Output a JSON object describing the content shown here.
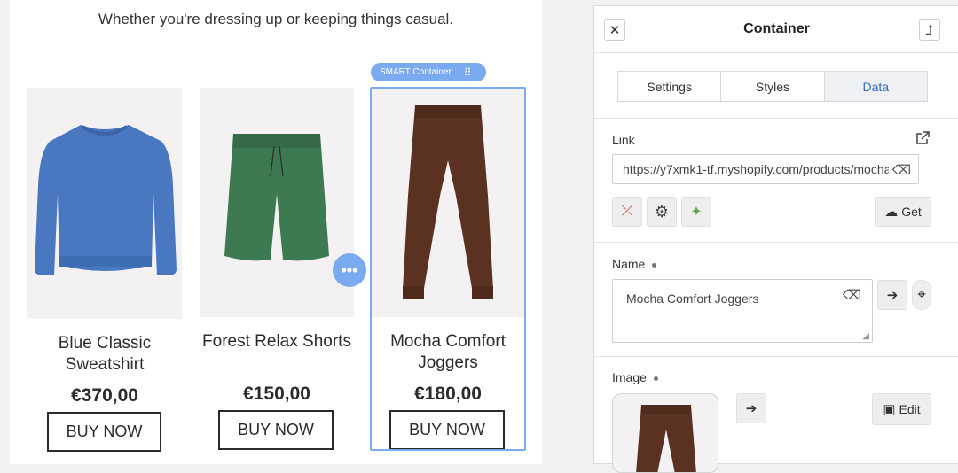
{
  "canvas": {
    "subtitle": "Whether you're dressing up or keeping things casual.",
    "smart_tag": "SMART Container",
    "more_button": "•••",
    "products": [
      {
        "name": "Blue Classic Sweatshirt",
        "price": "€370,00",
        "buy": "BUY NOW",
        "color": "#4a78c0"
      },
      {
        "name": "Forest Relax Shorts",
        "price": "€150,00",
        "buy": "BUY NOW",
        "color": "#3d7a52"
      },
      {
        "name": "Mocha Comfort Joggers",
        "price": "€180,00",
        "buy": "BUY NOW",
        "color": "#5b3222"
      }
    ]
  },
  "panel": {
    "title": "Container",
    "tabs": [
      {
        "label": "Settings",
        "active": false
      },
      {
        "label": "Styles",
        "active": false
      },
      {
        "label": "Data",
        "active": true
      }
    ],
    "link": {
      "label": "Link",
      "value": "https://y7xmk1-tf.myshopify.com/products/mocha",
      "get_label": "Get"
    },
    "name": {
      "label": "Name",
      "value": "Mocha Comfort Joggers"
    },
    "image": {
      "label": "Image",
      "edit_label": "Edit"
    }
  },
  "colors": {
    "accent": "#7aaaf0",
    "active_tab_text": "#2f6fbf"
  }
}
